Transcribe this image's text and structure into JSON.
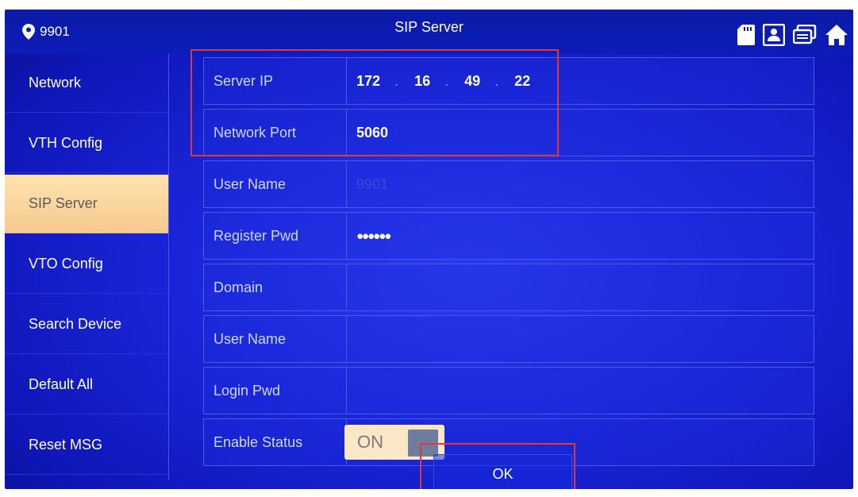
{
  "header": {
    "room_number": "9901",
    "title": "SIP Server",
    "icons": [
      "sd-card-icon",
      "contact-card-icon",
      "monitor-icon",
      "home-icon"
    ]
  },
  "sidebar": {
    "items": [
      {
        "label": "Network",
        "active": false
      },
      {
        "label": "VTH Config",
        "active": false
      },
      {
        "label": "SIP Server",
        "active": true
      },
      {
        "label": "VTO Config",
        "active": false
      },
      {
        "label": "Search Device",
        "active": false
      },
      {
        "label": "Default All",
        "active": false
      },
      {
        "label": "Reset MSG",
        "active": false
      }
    ]
  },
  "form": {
    "server_ip": {
      "label": "Server IP",
      "octets": [
        "172",
        "16",
        "49",
        "22"
      ]
    },
    "network_port": {
      "label": "Network Port",
      "value": "5060"
    },
    "user_name": {
      "label": "User Name",
      "value": "9901"
    },
    "register_pwd": {
      "label": "Register Pwd",
      "value": "●●●●●●"
    },
    "domain": {
      "label": "Domain",
      "value": ""
    },
    "user_name_2": {
      "label": "User Name",
      "value": ""
    },
    "login_pwd": {
      "label": "Login Pwd",
      "value": ""
    },
    "enable_status": {
      "label": "Enable Status",
      "value": "ON"
    }
  },
  "ok_label": "OK",
  "colors": {
    "background": "#1a25d8",
    "active_tab": "#f6c98e",
    "highlight": "#d93a3a"
  }
}
